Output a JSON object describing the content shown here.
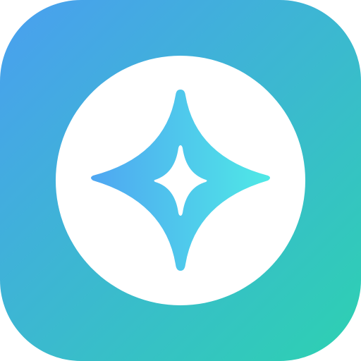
{
  "icon": {
    "name": "sparkle-app-icon",
    "background_gradient": {
      "start": "#4a9ff0",
      "end": "#2dd1b1"
    },
    "badge_color": "#ffffff",
    "star_gradient": {
      "start": "#4fa6f2",
      "end": "#4fe9e6"
    },
    "inner_star_color": "#ffffff"
  }
}
